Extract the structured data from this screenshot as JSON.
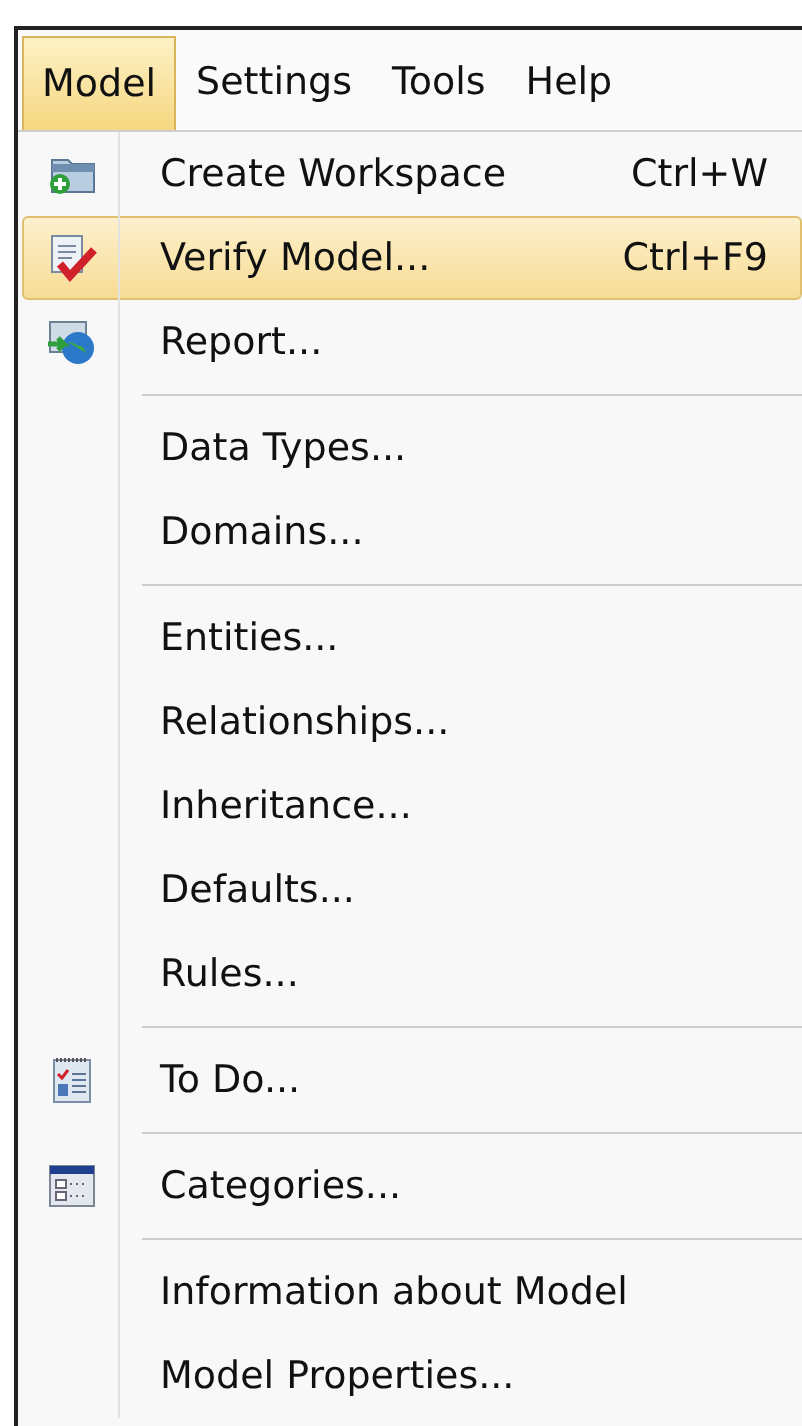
{
  "menu_bar": [
    {
      "label": "Model",
      "selected": true
    },
    {
      "label": "Settings",
      "selected": false
    },
    {
      "label": "Tools",
      "selected": false
    },
    {
      "label": "Help",
      "selected": false
    }
  ],
  "menu": [
    {
      "kind": "item",
      "label": "Create Workspace",
      "shortcut": "Ctrl+W",
      "selected": false
    },
    {
      "kind": "item",
      "label": "Verify Model...",
      "shortcut": "Ctrl+F9",
      "selected": true
    },
    {
      "kind": "item",
      "label": "Report...",
      "selected": false
    },
    {
      "kind": "separator"
    },
    {
      "kind": "item",
      "label": "Data Types...",
      "selected": false
    },
    {
      "kind": "item",
      "label": "Domains...",
      "selected": false
    },
    {
      "kind": "separator"
    },
    {
      "kind": "item",
      "label": "Entities...",
      "selected": false
    },
    {
      "kind": "item",
      "label": "Relationships...",
      "selected": false
    },
    {
      "kind": "item",
      "label": "Inheritance...",
      "selected": false
    },
    {
      "kind": "item",
      "label": "Defaults...",
      "selected": false
    },
    {
      "kind": "item",
      "label": "Rules...",
      "selected": false
    },
    {
      "kind": "separator"
    },
    {
      "kind": "item",
      "label": "To Do...",
      "selected": false
    },
    {
      "kind": "separator"
    },
    {
      "kind": "item",
      "label": "Categories...",
      "selected": false
    },
    {
      "kind": "separator"
    },
    {
      "kind": "item",
      "label": "Information about Model",
      "selected": false
    },
    {
      "kind": "item",
      "label": "Model Properties...",
      "selected": false
    }
  ]
}
